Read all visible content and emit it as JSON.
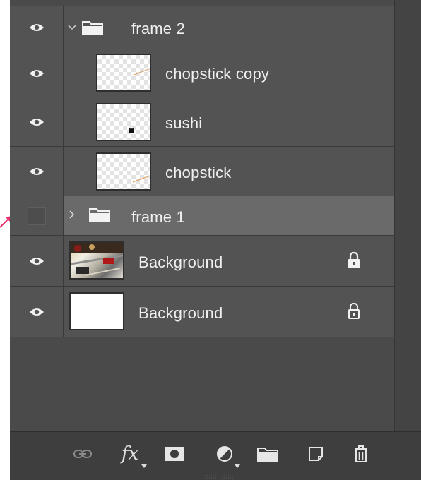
{
  "layers": [
    {
      "name": "frame 2",
      "type": "group",
      "expanded": true,
      "visible": true,
      "selected": false
    },
    {
      "name": "chopstick copy",
      "type": "layer",
      "thumbnail": "transparent-with-stroke",
      "visible": true
    },
    {
      "name": "sushi",
      "type": "layer",
      "thumbnail": "transparent-with-dot",
      "visible": true
    },
    {
      "name": "chopstick",
      "type": "layer",
      "thumbnail": "transparent-with-stroke",
      "visible": true
    },
    {
      "name": "frame 1",
      "type": "group",
      "expanded": false,
      "visible": false,
      "selected": true
    },
    {
      "name": "Background",
      "type": "layer",
      "thumbnail": "photo",
      "visible": true,
      "locked": true,
      "lock_style": "filled"
    },
    {
      "name": "Background",
      "type": "layer",
      "thumbnail": "white",
      "visible": true,
      "locked": true,
      "lock_style": "outline"
    }
  ],
  "toolbar": {
    "fx_label": "fx",
    "tools": [
      "link-layers-icon",
      "fx-icon",
      "layer-mask-icon",
      "adjustment-layer-icon",
      "new-group-icon",
      "new-layer-icon",
      "delete-icon"
    ]
  },
  "colors": {
    "panel_bg": "#535353",
    "selected_row": "#6a6a6a",
    "pointer": "#e8336a"
  }
}
